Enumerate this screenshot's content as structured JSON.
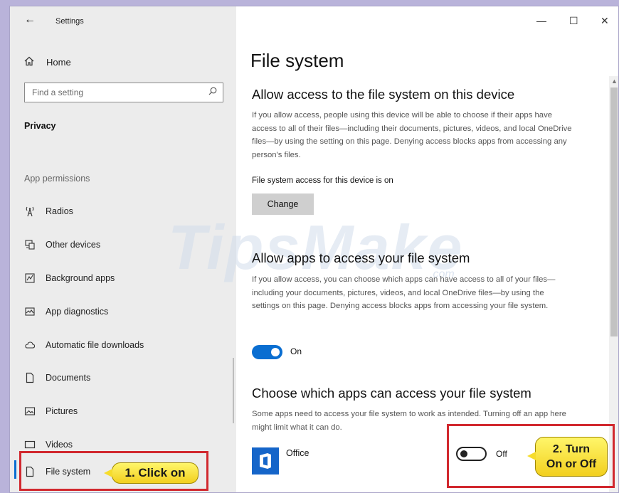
{
  "window": {
    "title": "Settings",
    "controls": {
      "minimize": "—",
      "maximize": "☐",
      "close": "✕"
    }
  },
  "sidebar": {
    "home_label": "Home",
    "search_placeholder": "Find a setting",
    "section_title": "Privacy",
    "group_label": "App permissions",
    "items": [
      {
        "label": "Radios",
        "icon": "radio-tower-icon"
      },
      {
        "label": "Other devices",
        "icon": "devices-icon"
      },
      {
        "label": "Background apps",
        "icon": "background-apps-icon"
      },
      {
        "label": "App diagnostics",
        "icon": "diagnostics-icon"
      },
      {
        "label": "Automatic file downloads",
        "icon": "cloud-icon"
      },
      {
        "label": "Documents",
        "icon": "document-icon"
      },
      {
        "label": "Pictures",
        "icon": "picture-icon"
      },
      {
        "label": "Videos",
        "icon": "video-icon"
      },
      {
        "label": "File system",
        "icon": "file-icon",
        "selected": true
      }
    ]
  },
  "main": {
    "title": "File system",
    "sections": [
      {
        "heading": "Allow access to the file system on this device",
        "description": "If you allow access, people using this device will be able to choose if their apps have access to all of their files—including their documents, pictures, videos, and local OneDrive files—by using the setting on this page. Denying access blocks apps from accessing any person's files.",
        "status": "File system access for this device is on",
        "button": "Change"
      },
      {
        "heading": "Allow apps to access your file system",
        "description": "If you allow access, you can choose which apps can have access to all of your files—including your documents, pictures, videos, and local OneDrive files—by using the settings on this page. Denying access blocks apps from accessing your file system.",
        "toggle_label": "On",
        "toggle_on": true
      },
      {
        "heading": "Choose which apps can access your file system",
        "description": "Some apps need to access your file system to work as intended. Turning off an app here might limit what it can do.",
        "apps": [
          {
            "name": "Office",
            "toggle_label": "Off",
            "toggle_on": false
          }
        ]
      }
    ]
  },
  "annotations": {
    "callout1": "1. Click on",
    "callout2_line1": "2. Turn",
    "callout2_line2": "On or Off"
  },
  "watermark": {
    "main": "TipsMake",
    "suffix": ".com"
  },
  "colors": {
    "accent": "#0a6ed1",
    "annotation_red": "#d1282e",
    "callout_yellow": "#f8e23a",
    "sidebar_bg": "#ececec"
  }
}
